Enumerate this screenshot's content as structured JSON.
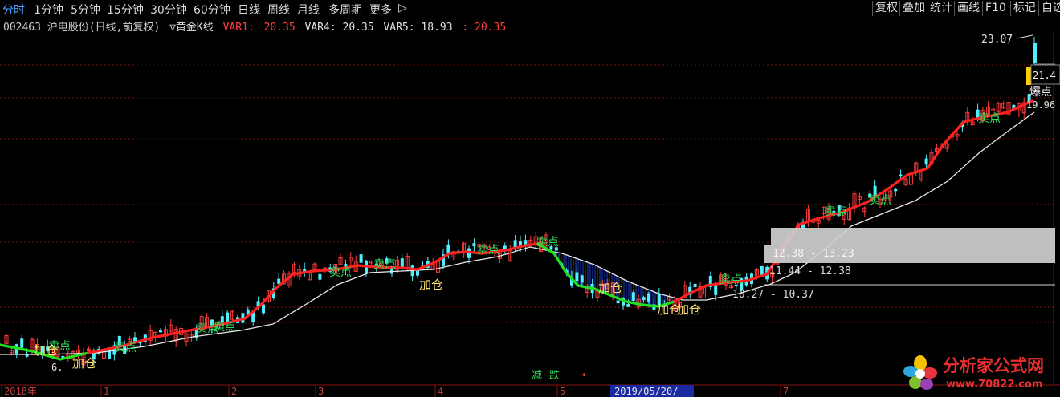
{
  "toolbar": {
    "periods": [
      "分时",
      "1分钟",
      "5分钟",
      "15分钟",
      "30分钟",
      "60分钟",
      "日线",
      "周线",
      "月线",
      "多周期",
      "更多",
      "▷"
    ],
    "tools": [
      "复权",
      "叠加",
      "统计",
      "画线",
      "F10",
      "标记",
      "自选"
    ]
  },
  "info": {
    "stock": "002463 沪电股份(日线,前复权)",
    "indicator": "▽黄金K线",
    "var1_label": "VAR1:",
    "var1_value": "20.35",
    "var4": "VAR4: 20.35",
    "var5": "VAR5: 18.93",
    "extra": ": 20.35"
  },
  "price_labels": {
    "high": "23.07",
    "current": "21.4",
    "burst": "爆点",
    "low_right": "19.96",
    "low_left": "6."
  },
  "zones": [
    {
      "label": "12.38 - 13.23"
    },
    {
      "label": "11.44 - 12.38"
    },
    {
      "label": "10.27 - 10.37"
    }
  ],
  "signals": {
    "add": "加仓",
    "sell": "卖点"
  },
  "bottom_text": {
    "reduce": "减",
    "fall": "跌"
  },
  "xaxis": {
    "labels": [
      "2018年",
      "1",
      "2",
      "3",
      "4",
      "5",
      "2019/05/20/一",
      "7"
    ]
  },
  "logo": {
    "title": "分析家公式网",
    "url": "www.70822.com"
  },
  "colors": {
    "up": "#ff3b3b",
    "down": "#4ef0ff",
    "ma_up": "#ff2020",
    "ma_down": "#20e020",
    "ma2": "#e8e8e8",
    "grid": "#7a1010",
    "zone": "#c8c8c8",
    "signal_sell": "#30e060",
    "signal_add": "#ffe070"
  },
  "chart_data": {
    "type": "candlestick",
    "title": "002463 沪电股份(日线,前复权)",
    "price_markers": [
      23.07,
      21.4,
      19.96
    ],
    "zones": [
      [
        12.38,
        13.23
      ],
      [
        11.44,
        12.38
      ],
      [
        10.27,
        10.37
      ]
    ],
    "x_ticks": [
      "2018年",
      "1",
      "2",
      "3",
      "4",
      "5",
      "2019/05/20/一",
      "7"
    ]
  }
}
